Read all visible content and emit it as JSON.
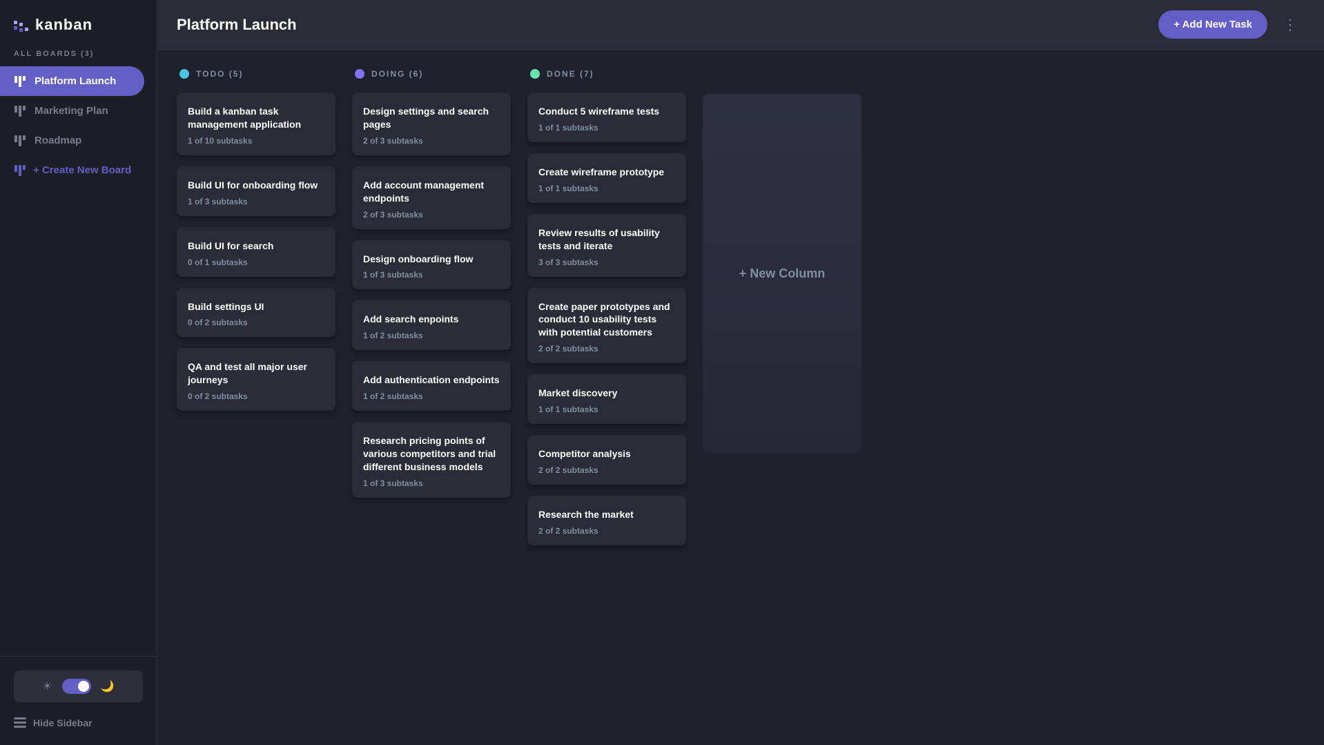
{
  "app": {
    "name": "kanban"
  },
  "sidebar": {
    "section_label": "ALL BOARDS (3)",
    "boards": [
      {
        "id": "platform-launch",
        "label": "Platform Launch",
        "active": true
      },
      {
        "id": "marketing-plan",
        "label": "Marketing Plan",
        "active": false
      },
      {
        "id": "roadmap",
        "label": "Roadmap",
        "active": false
      }
    ],
    "create_label": "+ Create New Board",
    "hide_sidebar_label": "Hide Sidebar"
  },
  "header": {
    "title": "Platform Launch",
    "add_task_label": "+ Add New Task",
    "more_icon": "⋮"
  },
  "board": {
    "columns": [
      {
        "id": "todo",
        "label": "TODO (5)",
        "dot_class": "dot-todo",
        "cards": [
          {
            "title": "Build a kanban task management application",
            "subtasks": "1 of 10 subtasks"
          },
          {
            "title": "Build UI for onboarding flow",
            "subtasks": "1 of 3 subtasks"
          },
          {
            "title": "Build UI for search",
            "subtasks": "0 of 1 subtasks"
          },
          {
            "title": "Build settings UI",
            "subtasks": "0 of 2 subtasks"
          },
          {
            "title": "QA and test all major user journeys",
            "subtasks": "0 of 2 subtasks"
          }
        ]
      },
      {
        "id": "doing",
        "label": "DOING (6)",
        "dot_class": "dot-doing",
        "cards": [
          {
            "title": "Design settings and search pages",
            "subtasks": "2 of 3 subtasks"
          },
          {
            "title": "Add account management endpoints",
            "subtasks": "2 of 3 subtasks"
          },
          {
            "title": "Design onboarding flow",
            "subtasks": "1 of 3 subtasks"
          },
          {
            "title": "Add search enpoints",
            "subtasks": "1 of 2 subtasks"
          },
          {
            "title": "Add authentication endpoints",
            "subtasks": "1 of 2 subtasks"
          },
          {
            "title": "Research pricing points of various competitors and trial different business models",
            "subtasks": "1 of 3 subtasks"
          }
        ]
      },
      {
        "id": "done",
        "label": "DONE (7)",
        "dot_class": "dot-done",
        "cards": [
          {
            "title": "Conduct 5 wireframe tests",
            "subtasks": "1 of 1 subtasks"
          },
          {
            "title": "Create wireframe prototype",
            "subtasks": "1 of 1 subtasks"
          },
          {
            "title": "Review results of usability tests and iterate",
            "subtasks": "3 of 3 subtasks"
          },
          {
            "title": "Create paper prototypes and conduct 10 usability tests with potential customers",
            "subtasks": "2 of 2 subtasks"
          },
          {
            "title": "Market discovery",
            "subtasks": "1 of 1 subtasks"
          },
          {
            "title": "Competitor analysis",
            "subtasks": "2 of 2 subtasks"
          },
          {
            "title": "Research the market",
            "subtasks": "2 of 2 subtasks"
          }
        ]
      }
    ],
    "new_column_label": "+ New Column"
  },
  "theme_toggle": {
    "sun_icon": "☀",
    "moon_icon": "🌙"
  }
}
